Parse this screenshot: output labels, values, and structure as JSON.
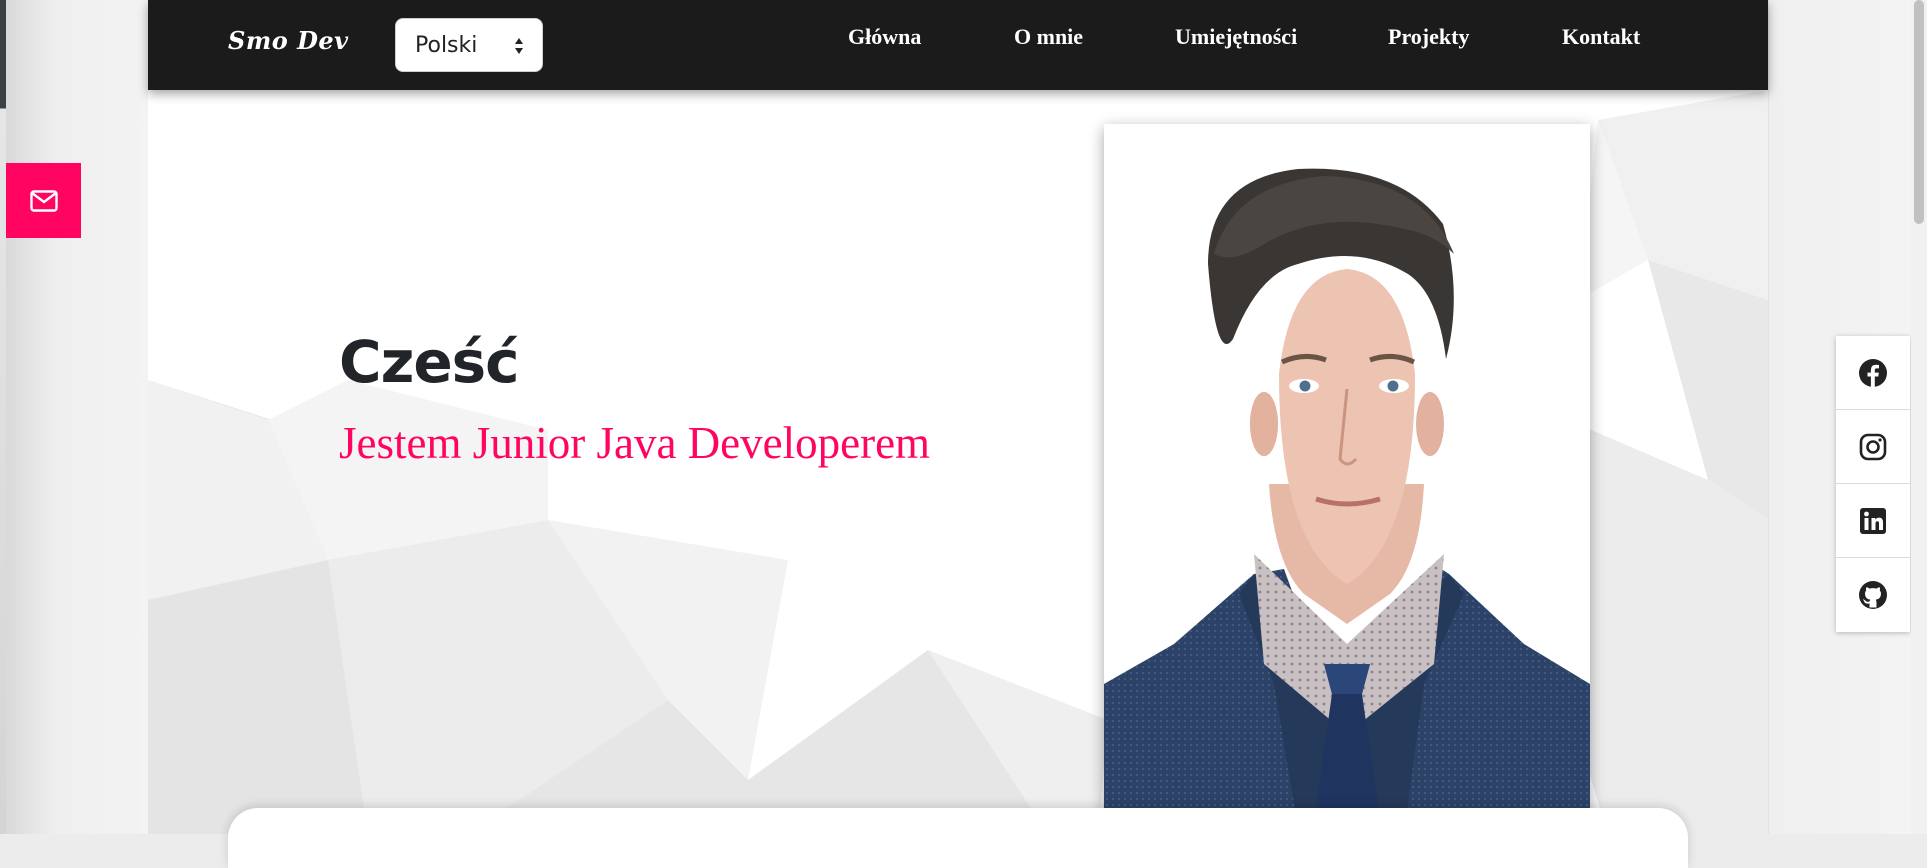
{
  "nav": {
    "brand": "Smo Dev",
    "language": {
      "selected": "Polski"
    },
    "links": [
      "Główna",
      "O mnie",
      "Umiejętności",
      "Projekty",
      "Kontakt"
    ]
  },
  "hero": {
    "greeting": "Cześć",
    "subtitle": "Jestem Junior Java Developerem"
  },
  "contact_tab": {
    "icon": "envelope-icon"
  },
  "social": {
    "items": [
      {
        "icon": "facebook-icon"
      },
      {
        "icon": "instagram-icon"
      },
      {
        "icon": "linkedin-icon"
      },
      {
        "icon": "github-icon"
      }
    ]
  },
  "colors": {
    "accent": "#ff0561",
    "navbar": "#1b1b1b",
    "text_dark": "#212529"
  }
}
